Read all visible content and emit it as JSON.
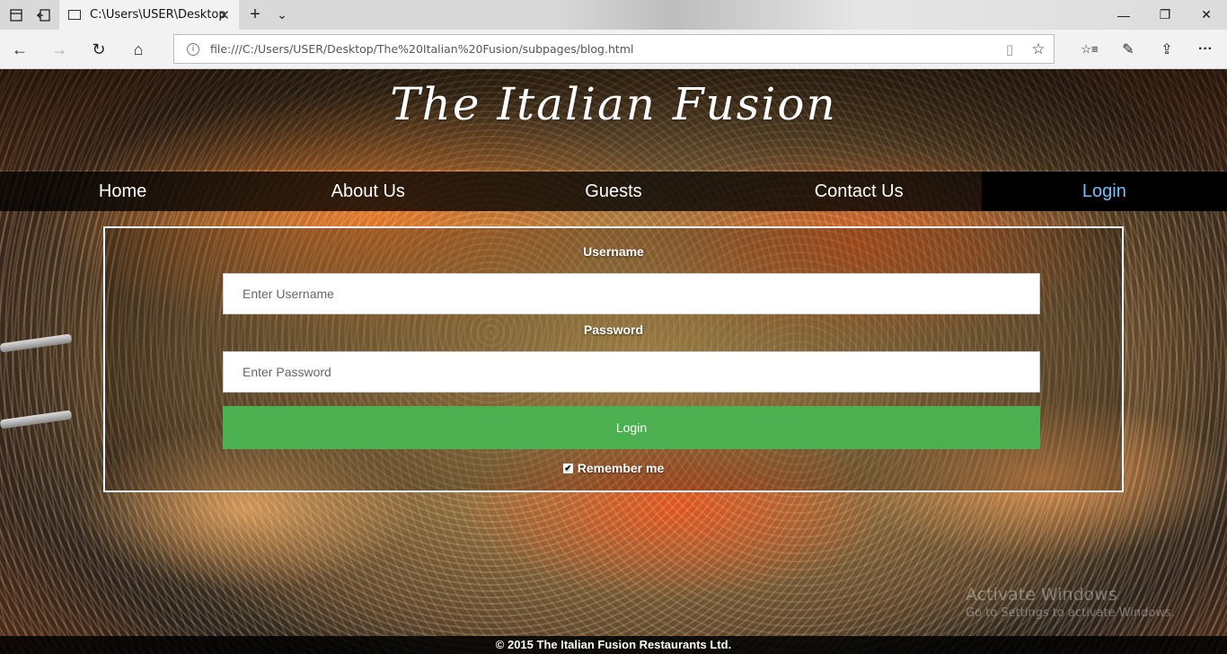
{
  "browser": {
    "tab_title": "C:\\Users\\USER\\Desktop",
    "url": "file:///C:/Users/USER/Desktop/The%20Italian%20Fusion/subpages/blog.html",
    "icons": {
      "tab_list": "tab-list-icon",
      "set_aside": "set-aside-icon",
      "close_tab": "✕",
      "new_tab": "+",
      "tab_menu": "⌄",
      "minimize": "—",
      "restore": "❐",
      "close_window": "✕",
      "back": "←",
      "forward": "→",
      "refresh": "↻",
      "home": "⌂",
      "info": "i",
      "reading_view": "▯",
      "favorite": "☆",
      "hub": "☆≡",
      "notes": "✎",
      "share": "⇪",
      "more": "···"
    }
  },
  "site": {
    "logo": "The Italian Fusion",
    "menu": [
      {
        "label": "Home"
      },
      {
        "label": "About Us"
      },
      {
        "label": "Guests"
      },
      {
        "label": "Contact Us"
      },
      {
        "label": "Login",
        "active": true
      }
    ],
    "login": {
      "username_label": "Username",
      "username_placeholder": "Enter Username",
      "username_value": "",
      "password_label": "Password",
      "password_placeholder": "Enter Password",
      "password_value": "",
      "button_label": "Login",
      "remember_label": "Remember me",
      "remember_checked": true
    },
    "footer": "© 2015 The Italian Fusion Restaurants Ltd.",
    "accent_color": "#4caf50",
    "active_menu_color": "#6fc0ff"
  },
  "watermark": {
    "line1": "Activate Windows",
    "line2": "Go to Settings to activate Windows."
  }
}
